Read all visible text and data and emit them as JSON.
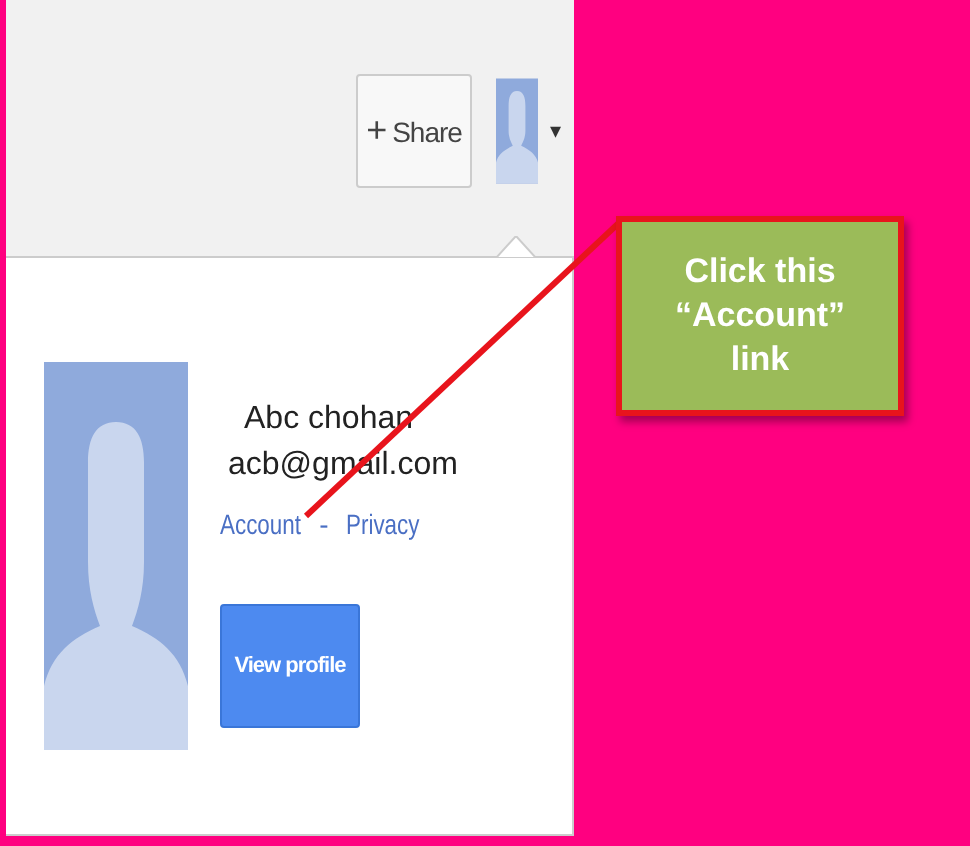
{
  "header": {
    "share_button": {
      "icon": "+",
      "label": "Share"
    },
    "account_caret": "▾"
  },
  "account_popup": {
    "name": "Abc chohan",
    "email": "acb@gmail.com",
    "links": [
      {
        "label": "Account"
      },
      {
        "label": "Privacy"
      }
    ],
    "separator": "-",
    "view_profile_button": "View profile"
  },
  "callout": {
    "text": "Click this “Account” link"
  }
}
